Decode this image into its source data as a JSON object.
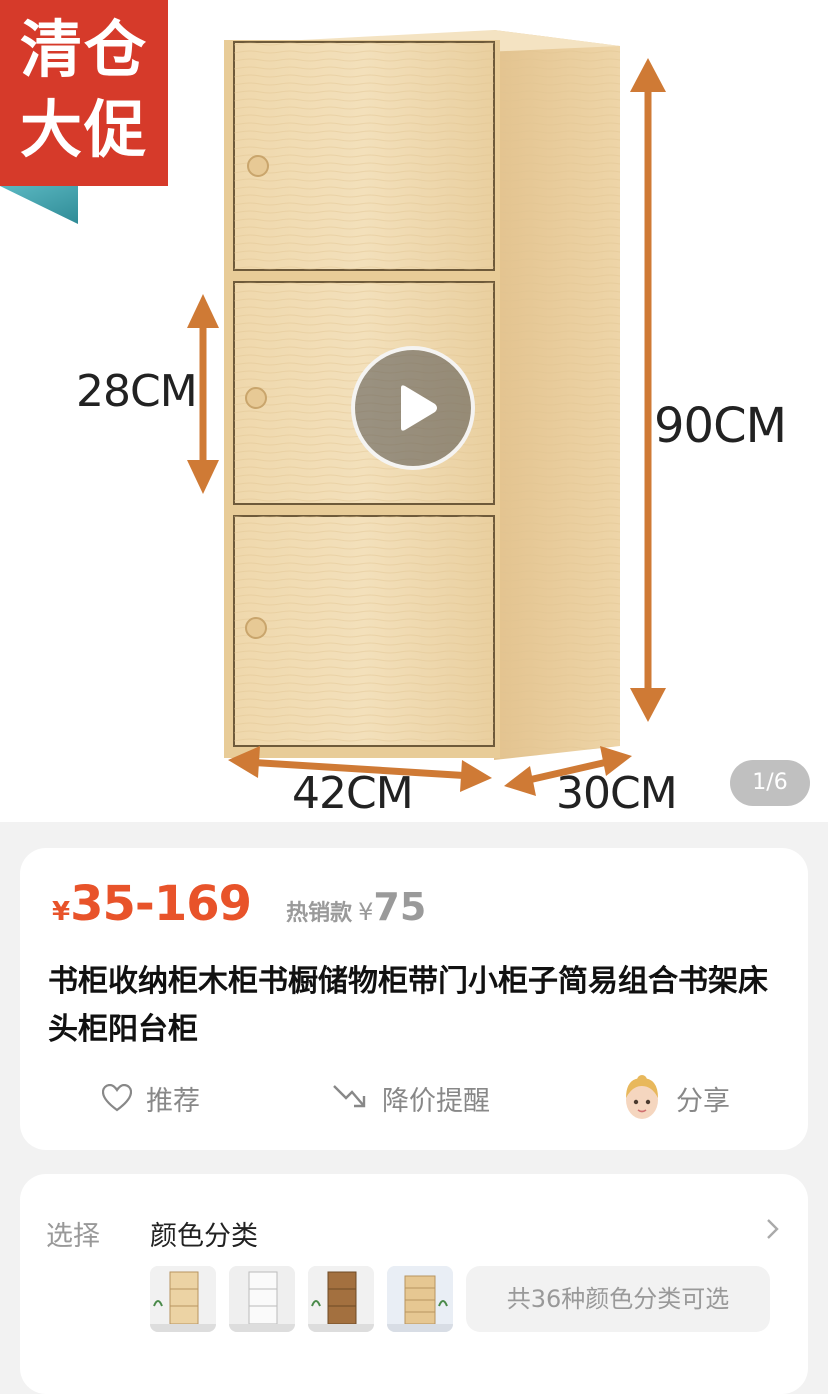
{
  "hero": {
    "badge_line1": "清仓",
    "badge_line2": "大促",
    "dim_height_small": "28CM",
    "dim_height_total": "90CM",
    "dim_width": "42CM",
    "dim_depth": "30CM",
    "image_counter": "1/6",
    "play_icon": "play-icon"
  },
  "product": {
    "price_currency": "¥",
    "price_range": "35-169",
    "hot_label": "热销款",
    "hot_currency": "¥",
    "hot_price": "75",
    "title": "书柜收纳柜木柜书橱储物柜带门小柜子简易组合书架床头柜阳台柜",
    "actions": [
      {
        "label": "推荐",
        "icon": "heart-icon"
      },
      {
        "label": "降价提醒",
        "icon": "price-drop-icon"
      },
      {
        "label": "分享",
        "icon": "avatar"
      }
    ]
  },
  "selection": {
    "label": "选择",
    "value": "颜色分类",
    "more_text": "共36种颜色分类可选"
  },
  "colors": {
    "price": "#e8532a",
    "badge": "#d63a2a",
    "wood": "#ecd3a4"
  }
}
